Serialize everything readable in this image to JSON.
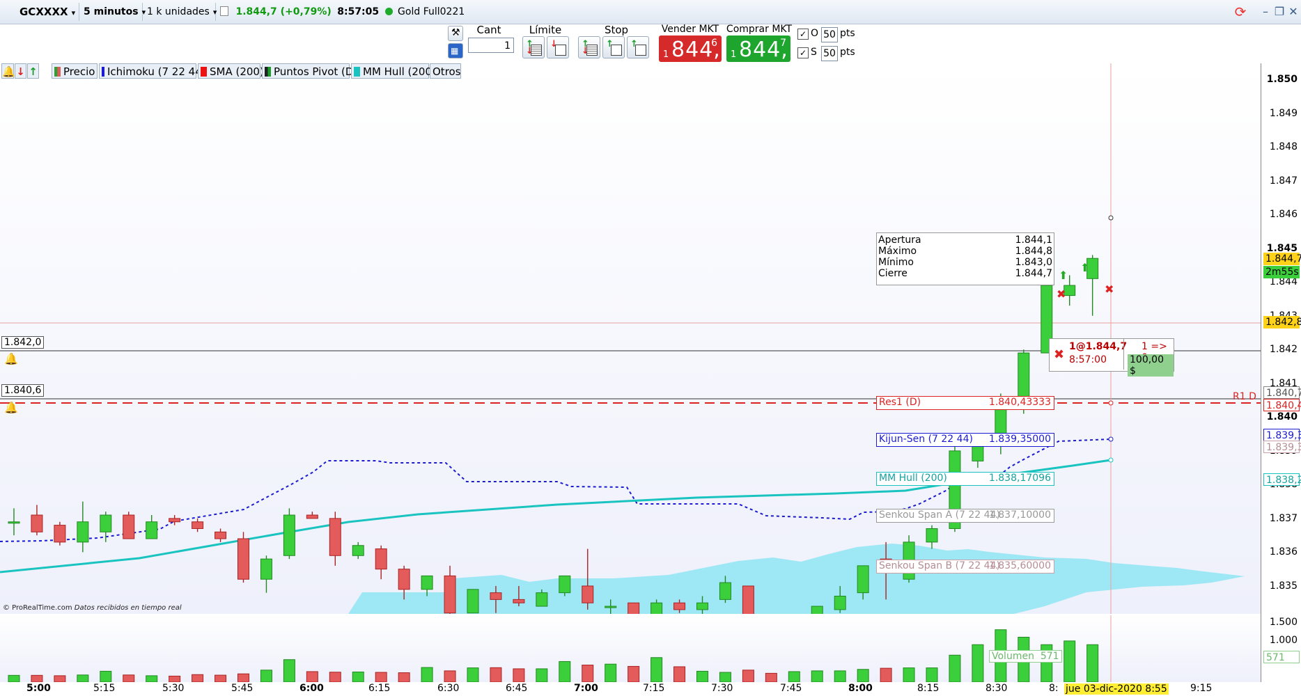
{
  "topbar": {
    "instrument": "GCXXXX",
    "timeframe": "5 minutos",
    "units": "1 k unidades",
    "price_change": "1.844,7 (+0,79%)",
    "time": "8:57:05",
    "feed_name": "Gold Full0221"
  },
  "order_panel": {
    "cant_label": "Cant",
    "cant_value": "1",
    "limite_label": "Límite",
    "stop_label": "Stop",
    "vender_label": "Vender MKT",
    "vender_small": "1",
    "vender_big": "844,",
    "vender_sup": "6",
    "comprar_label": "Comprar MKT",
    "comprar_small": "1",
    "comprar_big": "844,",
    "comprar_sup": "7",
    "o_label": "O",
    "o_value": "50",
    "s_label": "S",
    "s_value": "50",
    "pts_label": "pts"
  },
  "indicators": [
    {
      "label": "Precio",
      "color": "#3a9a3a"
    },
    {
      "label": "Ichimoku (7 22 44)",
      "color": "#1b1bd1"
    },
    {
      "label": "SMA (200)",
      "color": "#ee1111"
    },
    {
      "label": "Puntos Pivot (D)",
      "color": "#222222"
    },
    {
      "label": "MM Hull (200)",
      "color": "#19c4c0"
    },
    {
      "label": "Otros",
      "color": ""
    }
  ],
  "price_axis": {
    "labels": [
      "1.850",
      "1.849",
      "1.848",
      "1.847",
      "1.846",
      "1.845",
      "1.844",
      "1.843",
      "1.842",
      "1.841",
      "1.840",
      "1.839",
      "1.838",
      "1.837",
      "1.836",
      "1.835"
    ],
    "current_price": "1.844,7",
    "countdown": "2m55s",
    "line_price": "1.842,8",
    "tags": [
      "1.840,7",
      "1.840,4",
      "1.839,3",
      "1.839,3",
      "1.838,2"
    ],
    "volume_labels": [
      "1.500",
      "1.000",
      "500"
    ]
  },
  "time_axis": {
    "labels": [
      "5:00",
      "5:15",
      "5:30",
      "5:45",
      "6:00",
      "6:15",
      "6:30",
      "6:45",
      "7:00",
      "7:15",
      "7:30",
      "7:45",
      "8:00",
      "8:15",
      "8:30",
      "8:",
      "9:15"
    ],
    "cursor_label": "jue 03-dic-2020 8:55"
  },
  "ohlc_box": {
    "rows": [
      {
        "label": "Apertura",
        "value": "1.844,1"
      },
      {
        "label": "Máximo",
        "value": "1.844,8"
      },
      {
        "label": "Mínimo",
        "value": "1.843,0"
      },
      {
        "label": "Cierre",
        "value": "1.844,7"
      }
    ]
  },
  "order_tag": {
    "qty_price": "1@1.844,7",
    "time": "8:57:00",
    "change": "1 => 0",
    "pnl": "100,00 $"
  },
  "level_tags": {
    "res1_label": "Res1 (D)",
    "res1_value": "1.840,43333",
    "kijun_label": "Kijun-Sen (7 22 44)",
    "kijun_value": "1.839,35000",
    "hull_label": "MM Hull (200)",
    "hull_value": "1.838,17096",
    "senkou_a_label": "Senkou Span A (7 22 44)",
    "senkou_a_value": "1.837,10000",
    "senkou_b_label": "Senkou Span B (7 22 44)",
    "senkou_b_value": "1.835,60000",
    "r1_label": "R1 D",
    "alert1": "1.842,0",
    "alert2": "1.840,6"
  },
  "volume": {
    "label": "Volumen",
    "value": "571"
  },
  "footer": {
    "source": "© ProRealTime.com",
    "realtime": "Datos recibidos en tiempo real"
  },
  "chart_data": {
    "type": "candlestick",
    "ylim": [
      1834.6,
      1850.3
    ],
    "candles": [
      {
        "t": "5:00",
        "o": 1836.9,
        "h": 1837.3,
        "l": 1836.5,
        "c": 1836.9
      },
      {
        "t": "5:05",
        "o": 1837.1,
        "h": 1837.4,
        "l": 1836.5,
        "c": 1836.6
      },
      {
        "t": "5:10",
        "o": 1836.8,
        "h": 1836.9,
        "l": 1836.2,
        "c": 1836.3
      },
      {
        "t": "5:15",
        "o": 1836.3,
        "h": 1837.5,
        "l": 1836.0,
        "c": 1836.9
      },
      {
        "t": "5:20",
        "o": 1836.6,
        "h": 1837.2,
        "l": 1836.3,
        "c": 1837.1
      },
      {
        "t": "5:25",
        "o": 1837.1,
        "h": 1837.2,
        "l": 1836.4,
        "c": 1836.4
      },
      {
        "t": "5:30",
        "o": 1836.4,
        "h": 1837.1,
        "l": 1836.4,
        "c": 1836.9
      },
      {
        "t": "5:35",
        "o": 1837.0,
        "h": 1837.1,
        "l": 1836.8,
        "c": 1836.9
      },
      {
        "t": "5:40",
        "o": 1836.9,
        "h": 1837.0,
        "l": 1836.6,
        "c": 1836.7
      },
      {
        "t": "5:45",
        "o": 1836.6,
        "h": 1836.7,
        "l": 1836.3,
        "c": 1836.4
      },
      {
        "t": "5:50",
        "o": 1836.4,
        "h": 1836.6,
        "l": 1835.1,
        "c": 1835.2
      },
      {
        "t": "5:55",
        "o": 1835.2,
        "h": 1835.9,
        "l": 1834.8,
        "c": 1835.8
      },
      {
        "t": "6:00",
        "o": 1835.9,
        "h": 1837.3,
        "l": 1835.8,
        "c": 1837.1
      },
      {
        "t": "6:05",
        "o": 1837.1,
        "h": 1837.2,
        "l": 1837.0,
        "c": 1837.0
      },
      {
        "t": "6:10",
        "o": 1837.0,
        "h": 1837.2,
        "l": 1835.6,
        "c": 1835.9
      },
      {
        "t": "6:15",
        "o": 1835.9,
        "h": 1836.3,
        "l": 1835.8,
        "c": 1836.2
      },
      {
        "t": "6:20",
        "o": 1836.1,
        "h": 1836.2,
        "l": 1835.2,
        "c": 1835.5
      },
      {
        "t": "6:25",
        "o": 1835.5,
        "h": 1835.6,
        "l": 1834.6,
        "c": 1834.9
      },
      {
        "t": "6:30",
        "o": 1834.9,
        "h": 1835.3,
        "l": 1834.7,
        "c": 1835.3
      },
      {
        "t": "6:35",
        "o": 1835.3,
        "h": 1835.6,
        "l": 1833.9,
        "c": 1834.2
      },
      {
        "t": "6:40",
        "o": 1834.2,
        "h": 1834.9,
        "l": 1834.2,
        "c": 1834.9
      },
      {
        "t": "6:45",
        "o": 1834.8,
        "h": 1835.0,
        "l": 1834.2,
        "c": 1834.6
      },
      {
        "t": "6:50",
        "o": 1834.6,
        "h": 1835.0,
        "l": 1834.4,
        "c": 1834.5
      },
      {
        "t": "6:55",
        "o": 1834.4,
        "h": 1834.9,
        "l": 1834.4,
        "c": 1834.8
      },
      {
        "t": "7:00",
        "o": 1834.8,
        "h": 1835.3,
        "l": 1834.7,
        "c": 1835.3
      },
      {
        "t": "7:05",
        "o": 1835.0,
        "h": 1836.1,
        "l": 1834.3,
        "c": 1834.5
      },
      {
        "t": "7:10",
        "o": 1834.4,
        "h": 1834.6,
        "l": 1833.8,
        "c": 1834.4
      },
      {
        "t": "7:15",
        "o": 1834.5,
        "h": 1834.5,
        "l": 1833.8,
        "c": 1834.1
      },
      {
        "t": "7:20",
        "o": 1834.1,
        "h": 1834.6,
        "l": 1833.3,
        "c": 1834.5
      },
      {
        "t": "7:25",
        "o": 1834.5,
        "h": 1834.6,
        "l": 1834.2,
        "c": 1834.3
      },
      {
        "t": "7:30",
        "o": 1834.3,
        "h": 1834.7,
        "l": 1833.9,
        "c": 1834.5
      },
      {
        "t": "7:35",
        "o": 1834.6,
        "h": 1835.3,
        "l": 1834.5,
        "c": 1835.1
      },
      {
        "t": "7:40",
        "o": 1835.0,
        "h": 1835.0,
        "l": 1833.7,
        "c": 1834.1
      },
      {
        "t": "7:45",
        "o": 1834.1,
        "h": 1834.0,
        "l": 1832.6,
        "c": 1833.6
      },
      {
        "t": "7:50",
        "o": 1833.6,
        "h": 1833.9,
        "l": 1833.3,
        "c": 1833.6
      },
      {
        "t": "7:55",
        "o": 1833.6,
        "h": 1834.4,
        "l": 1833.5,
        "c": 1834.4
      },
      {
        "t": "8:00",
        "o": 1834.3,
        "h": 1835.0,
        "l": 1834.2,
        "c": 1834.7
      },
      {
        "t": "8:05",
        "o": 1834.8,
        "h": 1835.6,
        "l": 1834.6,
        "c": 1835.6
      },
      {
        "t": "8:10",
        "o": 1835.8,
        "h": 1836.3,
        "l": 1834.6,
        "c": 1835.4
      },
      {
        "t": "8:15",
        "o": 1835.2,
        "h": 1836.5,
        "l": 1835.1,
        "c": 1836.3
      },
      {
        "t": "8:20",
        "o": 1836.3,
        "h": 1836.8,
        "l": 1836.1,
        "c": 1836.7
      },
      {
        "t": "8:25",
        "o": 1836.7,
        "h": 1839.5,
        "l": 1836.6,
        "c": 1839.0
      },
      {
        "t": "8:30",
        "o": 1838.7,
        "h": 1839.3,
        "l": 1838.5,
        "c": 1839.3
      },
      {
        "t": "8:35",
        "o": 1839.2,
        "h": 1840.7,
        "l": 1838.9,
        "c": 1840.6
      },
      {
        "t": "8:40",
        "o": 1840.5,
        "h": 1842.0,
        "l": 1840.1,
        "c": 1841.9
      },
      {
        "t": "8:45",
        "o": 1841.9,
        "h": 1845.1,
        "l": 1842.2,
        "c": 1843.9
      },
      {
        "t": "8:50",
        "o": 1843.6,
        "h": 1844.2,
        "l": 1843.3,
        "c": 1843.9
      },
      {
        "t": "8:55",
        "o": 1844.1,
        "h": 1844.8,
        "l": 1843.0,
        "c": 1844.7
      }
    ],
    "volumes": [
      180,
      180,
      170,
      190,
      290,
      190,
      170,
      160,
      200,
      185,
      220,
      320,
      600,
      280,
      265,
      270,
      260,
      250,
      390,
      300,
      380,
      385,
      355,
      355,
      550,
      455,
      480,
      420,
      655,
      410,
      290,
      260,
      320,
      235,
      280,
      300,
      300,
      340,
      370,
      380,
      380,
      720,
      1000,
      1400,
      1200,
      1000,
      1100,
      1000
    ]
  }
}
